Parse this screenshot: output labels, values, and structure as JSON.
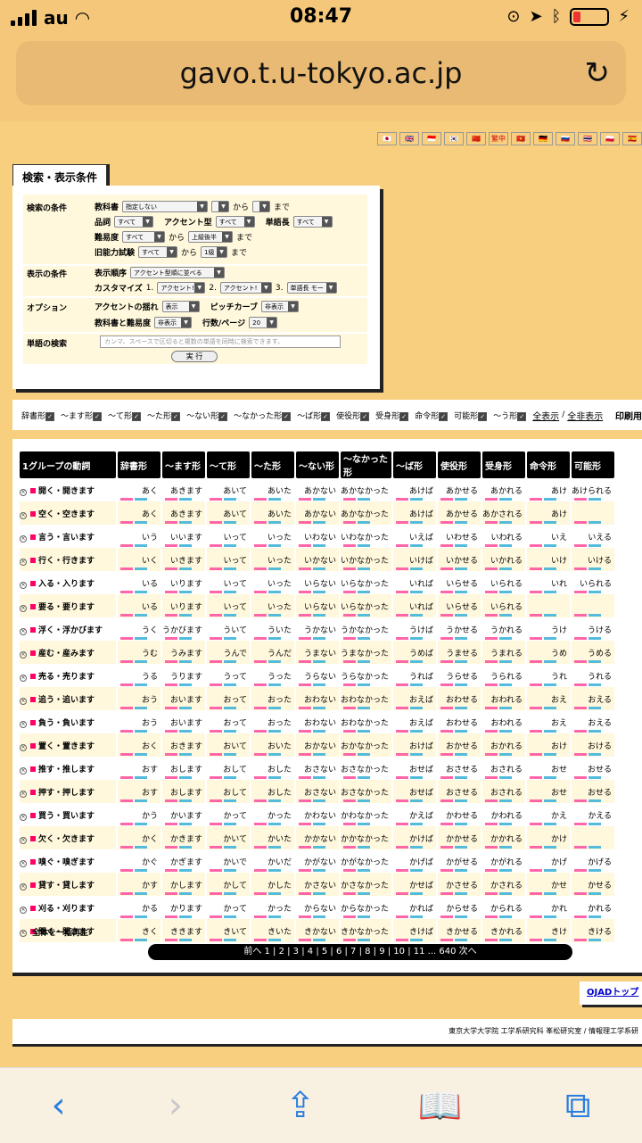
{
  "status": {
    "carrier": "au",
    "time": "08:47"
  },
  "url": "gavo.t.u-tokyo.ac.jp",
  "flags": [
    "🇯🇵",
    "🇬🇧",
    "🇮🇩",
    "🇰🇷",
    "🇨🇳",
    "繁中",
    "🇻🇳",
    "🇩🇪",
    "🇷🇺",
    "🇹🇭",
    "🇵🇱",
    "🇪🇸"
  ],
  "search": {
    "tab": "検索・表示条件",
    "cond_label": "検索の条件",
    "textbook": "教科書",
    "textbook_val": "指定しない",
    "kara": "から",
    "made": "まで",
    "pos": "品詞",
    "pos_val": "すべて",
    "accent": "アクセント型",
    "accent_val": "すべて",
    "len": "単語長",
    "len_val": "すべて",
    "diff": "難易度",
    "diff_val": "すべて",
    "diff_to": "上級後半",
    "jlpt": "旧能力試験",
    "jlpt_val": "すべて",
    "jlpt_to": "1級",
    "disp_label": "表示の条件",
    "order": "表示順序",
    "order_val": "アクセント型順に並べる",
    "custom": "カスタマイズ",
    "c1": "アクセント!",
    "c2": "アクセント!",
    "c3": "単語長 モー",
    "opt_label": "オプション",
    "sway": "アクセントの揺れ",
    "sway_val": "表示",
    "pitch": "ピッチカーブ",
    "pitch_val": "非表示",
    "tb_diff": "教科書と難易度",
    "tb_diff_val": "非表示",
    "rows": "行数/ページ",
    "rows_val": "20",
    "word_label": "単語の検索",
    "word_ph": "カンマ、スペースで区切ると複数の単語を同時に検索できます。",
    "exec": "実 行"
  },
  "checks": {
    "items": [
      "辞書形",
      "～ます形",
      "～て形",
      "～た形",
      "～ない形",
      "～なかった形",
      "～ば形",
      "使役形",
      "受身形",
      "命令形",
      "可能形",
      "～う形"
    ],
    "all_show": "全表示",
    "all_hide": "全非表示",
    "print": "印刷用"
  },
  "table": {
    "headers": [
      "1グループの動詞",
      "辞書形",
      "～ます形",
      "～て形",
      "～た形",
      "～ない形",
      "～なかった形",
      "～ば形",
      "使役形",
      "受身形",
      "命令形",
      "可能形"
    ],
    "rows": [
      [
        "開く・開きます",
        "あく",
        "あきます",
        "あいて",
        "あいた",
        "あかない",
        "あかなかった",
        "あけば",
        "あかせる",
        "あかれる",
        "あけ",
        "あけられる"
      ],
      [
        "空く・空きます",
        "あく",
        "あきます",
        "あいて",
        "あいた",
        "あかない",
        "あかなかった",
        "あけば",
        "あかせる",
        "あかされる",
        "あけ",
        ""
      ],
      [
        "言う・言います",
        "いう",
        "いいます",
        "いって",
        "いった",
        "いわない",
        "いわなかった",
        "いえば",
        "いわせる",
        "いわれる",
        "いえ",
        "いえる"
      ],
      [
        "行く・行きます",
        "いく",
        "いきます",
        "いって",
        "いった",
        "いかない",
        "いかなかった",
        "いけば",
        "いかせる",
        "いかれる",
        "いけ",
        "いける"
      ],
      [
        "入る・入ります",
        "いる",
        "いります",
        "いって",
        "いった",
        "いらない",
        "いらなかった",
        "いれば",
        "いらせる",
        "いられる",
        "いれ",
        "いられる"
      ],
      [
        "要る・要ります",
        "いる",
        "いります",
        "いって",
        "いった",
        "いらない",
        "いらなかった",
        "いれば",
        "いらせる",
        "いられる",
        "",
        ""
      ],
      [
        "浮く・浮かびます",
        "うく",
        "うかびます",
        "ういて",
        "ういた",
        "うかない",
        "うかなかった",
        "うけば",
        "うかせる",
        "うかれる",
        "うけ",
        "うける"
      ],
      [
        "産む・産みます",
        "うむ",
        "うみます",
        "うんで",
        "うんだ",
        "うまない",
        "うまなかった",
        "うめば",
        "うませる",
        "うまれる",
        "うめ",
        "うめる"
      ],
      [
        "売る・売ります",
        "うる",
        "うります",
        "うって",
        "うった",
        "うらない",
        "うらなかった",
        "うれば",
        "うらせる",
        "うられる",
        "うれ",
        "うれる"
      ],
      [
        "追う・追います",
        "おう",
        "おいます",
        "おって",
        "おった",
        "おわない",
        "おわなかった",
        "おえば",
        "おわせる",
        "おわれる",
        "おえ",
        "おえる"
      ],
      [
        "負う・負います",
        "おう",
        "おいます",
        "おって",
        "おった",
        "おわない",
        "おわなかった",
        "おえば",
        "おわせる",
        "おわれる",
        "おえ",
        "おえる"
      ],
      [
        "置く・置きます",
        "おく",
        "おきます",
        "おいて",
        "おいた",
        "おかない",
        "おかなかった",
        "おけば",
        "おかせる",
        "おかれる",
        "おけ",
        "おける"
      ],
      [
        "推す・推します",
        "おす",
        "おします",
        "おして",
        "おした",
        "おさない",
        "おさなかった",
        "おせば",
        "おさせる",
        "おされる",
        "おせ",
        "おせる"
      ],
      [
        "押す・押します",
        "おす",
        "おします",
        "おして",
        "おした",
        "おさない",
        "おさなかった",
        "おせば",
        "おさせる",
        "おされる",
        "おせ",
        "おせる"
      ],
      [
        "買う・買います",
        "かう",
        "かいます",
        "かって",
        "かった",
        "かわない",
        "かわなかった",
        "かえば",
        "かわせる",
        "かわれる",
        "かえ",
        "かえる"
      ],
      [
        "欠く・欠きます",
        "かく",
        "かきます",
        "かいて",
        "かいた",
        "かかない",
        "かかなかった",
        "かけば",
        "かかせる",
        "かかれる",
        "かけ",
        ""
      ],
      [
        "嗅ぐ・嗅ぎます",
        "かぐ",
        "かぎます",
        "かいで",
        "かいだ",
        "かがない",
        "かがなかった",
        "かげば",
        "かがせる",
        "かがれる",
        "かげ",
        "かげる"
      ],
      [
        "貸す・貸します",
        "かす",
        "かします",
        "かして",
        "かした",
        "かさない",
        "かさなかった",
        "かせば",
        "かさせる",
        "かされる",
        "かせ",
        "かせる"
      ],
      [
        "刈る・刈ります",
        "かる",
        "かります",
        "かって",
        "かった",
        "からない",
        "からなかった",
        "かれば",
        "からせる",
        "かられる",
        "かれ",
        "かれる"
      ],
      [
        "聞く・聞きます",
        "きく",
        "ききます",
        "きいて",
        "きいた",
        "きかない",
        "きかなかった",
        "きけば",
        "きかせる",
        "きかれる",
        "きけ",
        "きける"
      ]
    ],
    "all_play": "全体を一括再生",
    "pager": "前へ 1 | 2 | 3 | 4 | 5 | 6 | 7 | 8 | 9 | 10 | 11 ... 640 次へ"
  },
  "ojad": "OJADトップ",
  "footer": "東京大学大学院 工学系研究科 峯松研究室 / 情報理工学系研"
}
